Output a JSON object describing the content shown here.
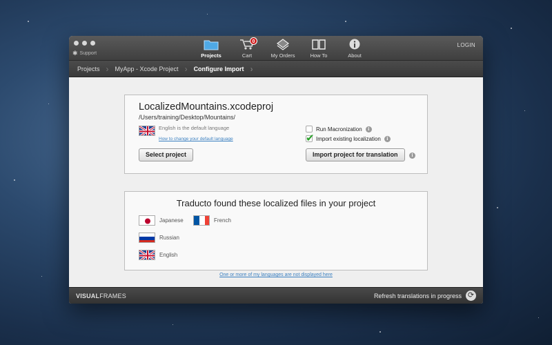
{
  "toolbar": {
    "support_label": "Support",
    "items": [
      {
        "label": "Projects",
        "icon": "folder-icon"
      },
      {
        "label": "Cart",
        "icon": "cart-icon",
        "badge": "0"
      },
      {
        "label": "My Orders",
        "icon": "orders-icon"
      },
      {
        "label": "How To",
        "icon": "book-icon"
      },
      {
        "label": "About",
        "icon": "info-icon"
      }
    ],
    "login_label": "LOGIN"
  },
  "breadcrumb": [
    "Projects",
    "MyApp - Xcode Project",
    "Configure Import"
  ],
  "project": {
    "name": "LocalizedMountains.xcodeproj",
    "path": "/Users/training/Desktop/Mountains/",
    "default_language_text": "English is the default language",
    "default_language_link": "How to change your default language",
    "select_button": "Select project",
    "run_macronization_label": "Run Macronization",
    "import_localization_label": "Import existing localization",
    "import_button": "Import project for translation"
  },
  "found": {
    "title": "Traducto found these localized files in your project",
    "languages": [
      "Japanese",
      "French",
      "Russian",
      "English"
    ]
  },
  "help_link": "One or more of my languages are not displayed here",
  "status": {
    "brand_bold": "VISUAL",
    "brand_rest": "FRAMES",
    "refresh_label": "Refresh translations in progress"
  },
  "colors": {
    "accent": "#3a7fc0",
    "badge": "#d02020",
    "check": "#2aa12a"
  }
}
